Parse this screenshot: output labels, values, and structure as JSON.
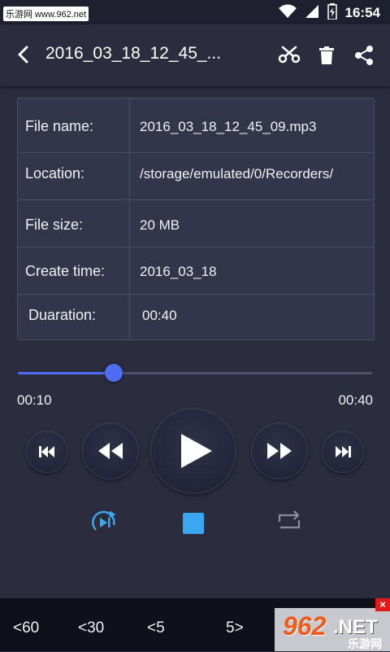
{
  "status_bar": {
    "watermark": "乐游网 www.962.net",
    "time": "16:54"
  },
  "header": {
    "title": "2016_03_18_12_45_...",
    "icons": [
      "back-arrow-icon",
      "scissors-icon",
      "trash-icon",
      "share-icon"
    ]
  },
  "file_info": {
    "rows": [
      {
        "label": "File name:",
        "value": "2016_03_18_12_45_09.mp3"
      },
      {
        "label": "Location:",
        "value": "/storage/emulated/0/Recorders/"
      },
      {
        "label": "File size:",
        "value": "20 MB"
      },
      {
        "label": "Create time:",
        "value": "2016_03_18"
      },
      {
        "label": "Duaration:",
        "value": "00:40"
      }
    ]
  },
  "player": {
    "elapsed": "00:10",
    "total": "00:40",
    "progress_fraction": 0.27,
    "accent_color": "#4d6df5",
    "active_mode_color": "#3aa8f0"
  },
  "skip_bar": {
    "buttons": [
      "<60",
      "<30",
      "<5",
      "5>"
    ]
  },
  "ad": {
    "close": "×",
    "brand": "962",
    "domain": ".NET",
    "sub": "乐游网"
  }
}
